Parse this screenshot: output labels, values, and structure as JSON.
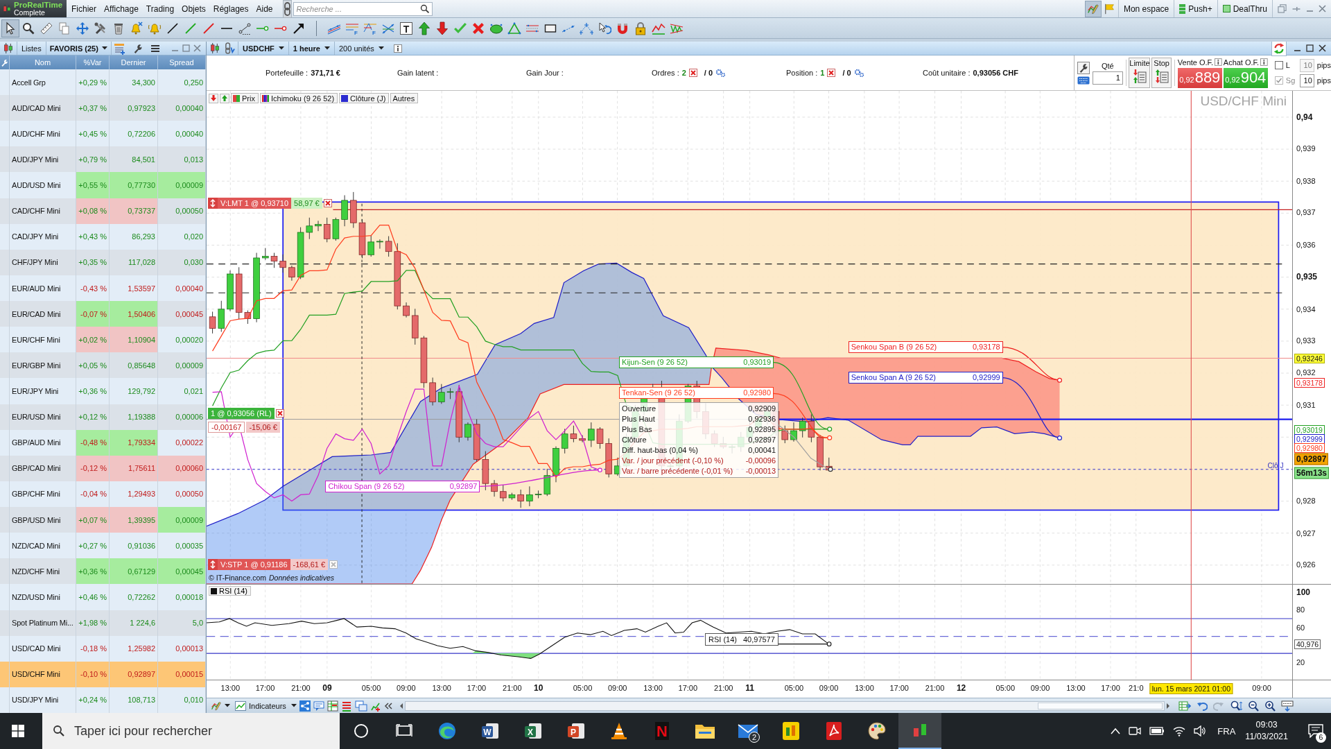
{
  "app": {
    "logo": "ProRealTime",
    "edition": "Complete",
    "menu": [
      "Fichier",
      "Affichage",
      "Trading",
      "Objets",
      "Réglages",
      "Aide"
    ],
    "search": {
      "placeholder": "Recherche ..."
    },
    "toggles": [
      {
        "kind": "pencil-chart",
        "pressed": true
      },
      {
        "kind": "flag",
        "pressed": false
      }
    ],
    "links": [
      {
        "label": "Mon espace",
        "kind": "plain"
      },
      {
        "label": "Push+",
        "kind": "bars"
      },
      {
        "label": "DealThru",
        "kind": "square"
      }
    ]
  },
  "drawing_toolbar": [
    {
      "tools": [
        {
          "kind": "cursor",
          "selected": true
        },
        {
          "kind": "magnifier",
          "selected": false
        },
        {
          "kind": "ruler",
          "selected": false
        },
        {
          "kind": "copy",
          "selected": false
        },
        {
          "kind": "move",
          "selected": false
        },
        {
          "kind": "tools",
          "selected": false
        },
        {
          "kind": "trash",
          "selected": false
        },
        {
          "kind": "bell-cross",
          "selected": false
        },
        {
          "kind": "bell",
          "selected": false
        },
        {
          "kind": "line-black",
          "selected": false
        },
        {
          "kind": "line-green",
          "selected": false
        },
        {
          "kind": "line-red",
          "selected": false
        },
        {
          "kind": "hline",
          "selected": false
        },
        {
          "kind": "segment",
          "selected": false
        },
        {
          "kind": "dot-green",
          "selected": false
        },
        {
          "kind": "dot-red",
          "selected": false
        },
        {
          "kind": "arrow",
          "selected": false
        }
      ]
    },
    {
      "tools": [
        {
          "kind": "channel",
          "selected": false
        },
        {
          "kind": "levels",
          "glyph": "F",
          "selected": false
        },
        {
          "kind": "levels-fan",
          "glyph": "F",
          "selected": false
        },
        {
          "kind": "crossing",
          "selected": false
        },
        {
          "kind": "text",
          "glyph": "T",
          "selected": false
        },
        {
          "kind": "up",
          "selected": false
        },
        {
          "kind": "down",
          "selected": false
        },
        {
          "kind": "check",
          "selected": false
        },
        {
          "kind": "cross",
          "selected": false
        },
        {
          "kind": "ellipse",
          "selected": false
        },
        {
          "kind": "triangle",
          "selected": false
        },
        {
          "kind": "parallel",
          "selected": false
        },
        {
          "kind": "rectangle",
          "selected": false
        },
        {
          "kind": "dotted",
          "selected": false
        },
        {
          "kind": "scatter",
          "selected": false
        },
        {
          "kind": "rotate",
          "selected": false
        },
        {
          "kind": "magnet",
          "selected": false
        },
        {
          "kind": "lock",
          "selected": false
        },
        {
          "kind": "zigzag",
          "selected": false
        },
        {
          "kind": "wave",
          "selected": false
        }
      ]
    }
  ],
  "watchlist": {
    "tab": "Listes",
    "list": "FAVORIS (25)",
    "columns": [
      "Nom",
      "%Var",
      "Dernier",
      "Spread"
    ],
    "rows": [
      {
        "selected": false,
        "cells": [
          {
            "text": "Accell Grp"
          },
          {
            "text": "+0,29 %",
            "negative": false
          },
          {
            "text": "34,300",
            "negative": false
          },
          {
            "text": "0,250",
            "negative": false
          }
        ]
      },
      {
        "selected": false,
        "cells": [
          {
            "text": "AUD/CAD Mini"
          },
          {
            "text": "+0,37 %",
            "negative": false
          },
          {
            "text": "0,97923",
            "negative": false
          },
          {
            "text": "0,00040",
            "negative": false
          }
        ]
      },
      {
        "selected": false,
        "cells": [
          {
            "text": "AUD/CHF Mini"
          },
          {
            "text": "+0,45 %",
            "negative": false
          },
          {
            "text": "0,72206",
            "negative": false
          },
          {
            "text": "0,00040",
            "negative": false
          }
        ]
      },
      {
        "selected": false,
        "cells": [
          {
            "text": "AUD/JPY Mini"
          },
          {
            "text": "+0,79 %",
            "negative": false
          },
          {
            "text": "84,501",
            "negative": false
          },
          {
            "text": "0,013",
            "negative": false
          }
        ]
      },
      {
        "selected": false,
        "cells": [
          {
            "text": "AUD/USD Mini"
          },
          {
            "text": "+0,55 %",
            "negative": false,
            "color": "#a6ec9e"
          },
          {
            "text": "0,77730",
            "negative": false,
            "color": "#a6ec9e"
          },
          {
            "text": "0,00009",
            "negative": false,
            "color": "#a6ec9e"
          }
        ]
      },
      {
        "selected": false,
        "cells": [
          {
            "text": "CAD/CHF Mini"
          },
          {
            "text": "+0,08 %",
            "negative": false,
            "color": "#f1c4c4"
          },
          {
            "text": "0,73737",
            "negative": false,
            "color": "#f1c4c4"
          },
          {
            "text": "0,00050",
            "negative": false
          }
        ]
      },
      {
        "selected": false,
        "cells": [
          {
            "text": "CAD/JPY Mini"
          },
          {
            "text": "+0,43 %",
            "negative": false
          },
          {
            "text": "86,293",
            "negative": false
          },
          {
            "text": "0,020",
            "negative": false
          }
        ]
      },
      {
        "selected": false,
        "cells": [
          {
            "text": "CHF/JPY Mini"
          },
          {
            "text": "+0,35 %",
            "negative": false
          },
          {
            "text": "117,028",
            "negative": false
          },
          {
            "text": "0,030",
            "negative": false
          }
        ]
      },
      {
        "selected": false,
        "cells": [
          {
            "text": "EUR/AUD Mini"
          },
          {
            "text": "-0,43 %",
            "negative": true
          },
          {
            "text": "1,53597",
            "negative": true
          },
          {
            "text": "0,00040",
            "negative": true
          }
        ]
      },
      {
        "selected": false,
        "cells": [
          {
            "text": "EUR/CAD Mini"
          },
          {
            "text": "-0,07 %",
            "negative": true,
            "color": "#a6ec9e"
          },
          {
            "text": "1,50406",
            "negative": true,
            "color": "#a6ec9e"
          },
          {
            "text": "0,00045",
            "negative": true
          }
        ]
      },
      {
        "selected": false,
        "cells": [
          {
            "text": "EUR/CHF Mini"
          },
          {
            "text": "+0,02 %",
            "negative": false,
            "color": "#f1c4c4"
          },
          {
            "text": "1,10904",
            "negative": false,
            "color": "#f1c4c4"
          },
          {
            "text": "0,00020",
            "negative": false
          }
        ]
      },
      {
        "selected": false,
        "cells": [
          {
            "text": "EUR/GBP Mini"
          },
          {
            "text": "+0,05 %",
            "negative": false
          },
          {
            "text": "0,85648",
            "negative": false
          },
          {
            "text": "0,00009",
            "negative": false
          }
        ]
      },
      {
        "selected": false,
        "cells": [
          {
            "text": "EUR/JPY Mini"
          },
          {
            "text": "+0,36 %",
            "negative": false
          },
          {
            "text": "129,792",
            "negative": false
          },
          {
            "text": "0,021",
            "negative": false
          }
        ]
      },
      {
        "selected": false,
        "cells": [
          {
            "text": "EUR/USD Mini"
          },
          {
            "text": "+0,12 %",
            "negative": false
          },
          {
            "text": "1,19388",
            "negative": false
          },
          {
            "text": "0,00006",
            "negative": false
          }
        ]
      },
      {
        "selected": false,
        "cells": [
          {
            "text": "GBP/AUD Mini"
          },
          {
            "text": "-0,48 %",
            "negative": true,
            "color": "#a6ec9e"
          },
          {
            "text": "1,79334",
            "negative": true,
            "color": "#a6ec9e"
          },
          {
            "text": "0,00022",
            "negative": true
          }
        ]
      },
      {
        "selected": false,
        "cells": [
          {
            "text": "GBP/CAD Mini"
          },
          {
            "text": "-0,12 %",
            "negative": true,
            "color": "#f1c4c4"
          },
          {
            "text": "1,75611",
            "negative": true,
            "color": "#f1c4c4"
          },
          {
            "text": "0,00060",
            "negative": true,
            "color": "#f1c4c4"
          }
        ]
      },
      {
        "selected": false,
        "cells": [
          {
            "text": "GBP/CHF Mini"
          },
          {
            "text": "-0,04 %",
            "negative": true
          },
          {
            "text": "1,29493",
            "negative": true
          },
          {
            "text": "0,00050",
            "negative": true
          }
        ]
      },
      {
        "selected": false,
        "cells": [
          {
            "text": "GBP/USD Mini"
          },
          {
            "text": "+0,07 %",
            "negative": false,
            "color": "#f1c4c4"
          },
          {
            "text": "1,39395",
            "negative": false,
            "color": "#f1c4c4"
          },
          {
            "text": "0,00009",
            "negative": false,
            "color": "#a6ec9e"
          }
        ]
      },
      {
        "selected": false,
        "cells": [
          {
            "text": "NZD/CAD Mini"
          },
          {
            "text": "+0,27 %",
            "negative": false
          },
          {
            "text": "0,91036",
            "negative": false
          },
          {
            "text": "0,00035",
            "negative": false
          }
        ]
      },
      {
        "selected": false,
        "cells": [
          {
            "text": "NZD/CHF Mini"
          },
          {
            "text": "+0,36 %",
            "negative": false,
            "color": "#a6ec9e"
          },
          {
            "text": "0,67129",
            "negative": false,
            "color": "#a6ec9e"
          },
          {
            "text": "0,00045",
            "negative": false,
            "color": "#a6ec9e"
          }
        ]
      },
      {
        "selected": false,
        "cells": [
          {
            "text": "NZD/USD Mini"
          },
          {
            "text": "+0,46 %",
            "negative": false
          },
          {
            "text": "0,72262",
            "negative": false
          },
          {
            "text": "0,00018",
            "negative": false
          }
        ]
      },
      {
        "selected": false,
        "cells": [
          {
            "text": "Spot Platinum Mi..."
          },
          {
            "text": "+1,98 %",
            "negative": false
          },
          {
            "text": "1 224,6",
            "negative": false
          },
          {
            "text": "5,0",
            "negative": false
          }
        ]
      },
      {
        "selected": false,
        "cells": [
          {
            "text": "USD/CAD Mini"
          },
          {
            "text": "-0,18 %",
            "negative": true
          },
          {
            "text": "1,25982",
            "negative": true
          },
          {
            "text": "0,00013",
            "negative": true
          }
        ]
      },
      {
        "selected": true,
        "cells": [
          {
            "text": "USD/CHF Mini"
          },
          {
            "text": "-0,10 %",
            "negative": true
          },
          {
            "text": "0,92897",
            "negative": true
          },
          {
            "text": "0,00015",
            "negative": true
          }
        ]
      },
      {
        "selected": false,
        "cells": [
          {
            "text": "USD/JPY Mini"
          },
          {
            "text": "+0,24 %",
            "negative": false
          },
          {
            "text": "108,713",
            "negative": false
          },
          {
            "text": "0,010",
            "negative": false
          }
        ]
      }
    ]
  },
  "chart": {
    "symbol": "USDCHF",
    "period": "1 heure",
    "units": "200 unités",
    "account": [
      {
        "kind": "amount",
        "label": "Portefeuille :",
        "value": "371,71 €"
      },
      {
        "kind": "amount",
        "label": "Gain latent :"
      },
      {
        "kind": "amount",
        "label": "Gain Jour :"
      },
      {
        "kind": "count",
        "label": "Ordres :",
        "value": "2",
        "pending": "/ 0"
      },
      {
        "kind": "count",
        "label": "Position :",
        "value": "1",
        "pending": "/ 0"
      },
      {
        "kind": "amount",
        "label": "Coût unitaire :",
        "value": "0,93056 CHF"
      }
    ],
    "ticket": {
      "qty_label": "Qté",
      "qty": "1",
      "limit": "Limite",
      "stop": "Stop",
      "sell": {
        "label": "Vente O.F.",
        "prefix": "0,92",
        "price": "889"
      },
      "buy": {
        "label": "Achat O.F.",
        "prefix": "0,92",
        "price": "904"
      },
      "options": [
        {
          "label": "L",
          "checked": false,
          "disabled": false,
          "value": "10",
          "value_disabled": true,
          "unit": "pips"
        },
        {
          "label": "Sg",
          "checked": true,
          "disabled": true,
          "value": "10",
          "value_disabled": false,
          "unit": "pips"
        }
      ]
    },
    "legend": [
      {
        "kind": "price",
        "label": "Prix"
      },
      {
        "kind": "ichimoku",
        "label": "Ichimoku (9 26 52)"
      },
      {
        "kind": "line",
        "label": "Clôture (J)"
      },
      {
        "kind": "more",
        "label": "Autres"
      }
    ],
    "title": "USD/CHF Mini",
    "orders": [
      {
        "kind": "limit",
        "label": "V:LMT 1 @ 0,93710",
        "pnl": "58,97 €",
        "profit": true
      },
      {
        "kind": "position",
        "label": "1 @ 0,93056 (RL)",
        "diff": "-0,00167",
        "pnl": "-15,06 €",
        "profit": false
      },
      {
        "kind": "stop",
        "label": "V:STP 1 @ 0,91186",
        "pnl": "-168,61 €",
        "profit": false
      }
    ],
    "indicators": [
      {
        "label": "Kijun-Sen (9 26 52)",
        "value": "0,93019",
        "color": "#22a022"
      },
      {
        "label": "Tenkan-Sen (9 26 52)",
        "value": "0,92980",
        "color": "#ff3c1e"
      },
      {
        "label": "Chikou Span (9 26 52)",
        "value": "0,92897",
        "color": "#d020d0"
      },
      {
        "label": "Senkou Span B (9 26 52)",
        "value": "0,93178",
        "color": "#ee2020"
      },
      {
        "label": "Senkou Span A (9 26 52)",
        "value": "0,92999",
        "color": "#2020c8"
      }
    ],
    "ohlc": [
      {
        "label": "Ouverture",
        "value": "0,92909",
        "negative": false
      },
      {
        "label": "Plus Haut",
        "value": "0,92936",
        "negative": false
      },
      {
        "label": "Plus Bas",
        "value": "0,92895",
        "negative": false
      },
      {
        "label": "Clôture",
        "value": "0,92897",
        "negative": false
      },
      {
        "label": "Diff. haut-bas (0,04 %)",
        "value": "0,00041",
        "negative": false
      },
      {
        "label": "Var. / jour précédent (-0,10 %)",
        "value": "-0,00096",
        "negative": true
      },
      {
        "label": "Var. / barre précédente (-0,01 %)",
        "value": "-0,00013",
        "negative": true
      }
    ],
    "close_label": "Clô J",
    "source": "© IT-Finance.com",
    "disclaimer": "Données indicatives",
    "y_axis": [
      {
        "label": "0,94",
        "major": true
      },
      {
        "label": "0,939",
        "major": false
      },
      {
        "label": "0,938",
        "major": false
      },
      {
        "label": "0,937",
        "major": false
      },
      {
        "label": "0,936",
        "major": false
      },
      {
        "label": "0,935",
        "major": true
      },
      {
        "label": "0,934",
        "major": false
      },
      {
        "label": "0,933",
        "major": false
      },
      {
        "label": "0,932",
        "major": false
      },
      {
        "label": "0,931",
        "major": false
      },
      {
        "label": "0,928",
        "major": false
      },
      {
        "label": "0,927",
        "major": false
      },
      {
        "label": "0,926",
        "major": false
      }
    ],
    "price_tags": [
      {
        "label": "0,93246",
        "kind": "alert"
      },
      {
        "label": "0,93178",
        "kind": "line",
        "color": "#ee2020"
      },
      {
        "label": "0,93019",
        "kind": "line",
        "color": "#22a022"
      },
      {
        "label": "0,92999",
        "kind": "line",
        "color": "#2020c8"
      },
      {
        "label": "0,92980",
        "kind": "line",
        "color": "#ff3c1e"
      },
      {
        "label": "0,92897",
        "kind": "last"
      },
      {
        "label": "56m13s",
        "kind": "timer"
      }
    ],
    "rsi": {
      "legend": "RSI (14)",
      "label": "RSI (14)",
      "value": "40,97577",
      "axis": [
        {
          "label": "100",
          "major": true
        },
        {
          "label": "80",
          "major": false
        },
        {
          "label": "60",
          "major": false
        },
        {
          "label": "20",
          "major": false
        }
      ],
      "tag": "40,976"
    },
    "x_axis": [
      {
        "label": "13:00",
        "major": false
      },
      {
        "label": "17:00",
        "major": false
      },
      {
        "label": "21:00",
        "major": false
      },
      {
        "label": "09",
        "major": true
      },
      {
        "label": "05:00",
        "major": false
      },
      {
        "label": "09:00",
        "major": false
      },
      {
        "label": "13:00",
        "major": false
      },
      {
        "label": "17:00",
        "major": false
      },
      {
        "label": "21:00",
        "major": false
      },
      {
        "label": "10",
        "major": true
      },
      {
        "label": "05:00",
        "major": false
      },
      {
        "label": "09:00",
        "major": false
      },
      {
        "label": "13:00",
        "major": false
      },
      {
        "label": "17:00",
        "major": false
      },
      {
        "label": "21:00",
        "major": false
      },
      {
        "label": "11",
        "major": true
      },
      {
        "label": "05:00",
        "major": false
      },
      {
        "label": "09:00",
        "major": false
      },
      {
        "label": "13:00",
        "major": false
      },
      {
        "label": "17:00",
        "major": false
      },
      {
        "label": "21:00",
        "major": false
      },
      {
        "label": "12",
        "major": true
      },
      {
        "label": "05:00",
        "major": false
      },
      {
        "label": "09:00",
        "major": false
      },
      {
        "label": "13:00",
        "major": false
      },
      {
        "label": "17:00",
        "major": false
      },
      {
        "label": "21:0",
        "major": false
      },
      {
        "label": "09:00",
        "major": false
      }
    ],
    "cursor_time": "lun. 15 mars 2021 01:00",
    "indicators_button": "Indicateurs"
  },
  "taskbar": {
    "search": {
      "placeholder": "Taper ici pour rechercher"
    },
    "apps": [
      {
        "kind": "ring",
        "selected": false
      },
      {
        "kind": "panes",
        "selected": false
      },
      {
        "kind": "swirl",
        "selected": false
      },
      {
        "kind": "tile",
        "glyph": "W",
        "color": "#2b579a",
        "selected": false
      },
      {
        "kind": "tile",
        "glyph": "X",
        "color": "#217346",
        "selected": false
      },
      {
        "kind": "tile",
        "glyph": "P",
        "color": "#d24726",
        "selected": false
      },
      {
        "kind": "cone",
        "selected": false
      },
      {
        "kind": "letter",
        "glyph": "N",
        "color": "#e50914",
        "selected": false
      },
      {
        "kind": "folder",
        "selected": false
      },
      {
        "kind": "envelope",
        "badge": "2",
        "selected": false
      },
      {
        "kind": "bars",
        "selected": false
      },
      {
        "kind": "document",
        "selected": false
      },
      {
        "kind": "palette",
        "selected": false
      },
      {
        "kind": "candles",
        "selected": true
      }
    ],
    "language": "FRA",
    "time": "09:03",
    "date": "11/03/2021",
    "notifications": "6"
  }
}
